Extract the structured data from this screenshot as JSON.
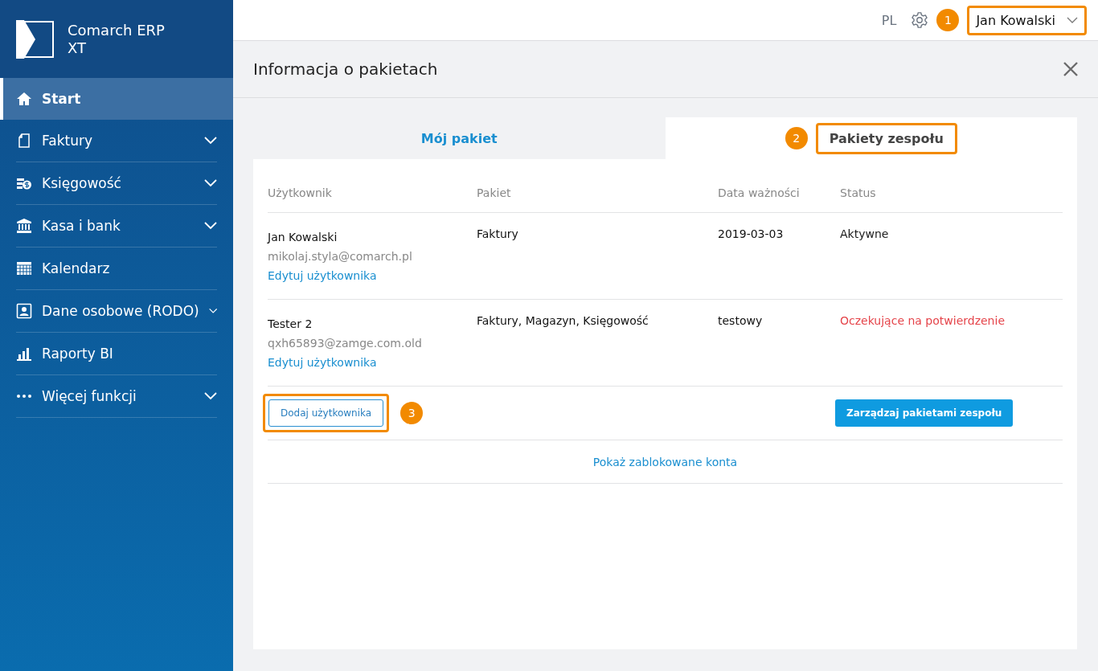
{
  "brand": {
    "line1": "Comarch ERP",
    "line2": "XT"
  },
  "sidebar": {
    "items": [
      {
        "kind": "home",
        "label": "Start",
        "selected": true,
        "expandable": false
      },
      {
        "kind": "document",
        "label": "Faktury",
        "selected": false,
        "expandable": true
      },
      {
        "kind": "money",
        "label": "Księgowość",
        "selected": false,
        "expandable": true
      },
      {
        "kind": "bank",
        "label": "Kasa i bank",
        "selected": false,
        "expandable": true
      },
      {
        "kind": "calendar",
        "label": "Kalendarz",
        "selected": false,
        "expandable": false
      },
      {
        "kind": "person",
        "label": "Dane osobowe (RODO)",
        "selected": false,
        "expandable": true
      },
      {
        "kind": "chart",
        "label": "Raporty BI",
        "selected": false,
        "expandable": false
      },
      {
        "kind": "dots",
        "label": "Więcej funkcji",
        "selected": false,
        "expandable": true
      }
    ]
  },
  "topbar": {
    "language": "PL",
    "user": {
      "name": "Jan Kowalski",
      "marker": "1",
      "highlighted": true
    }
  },
  "page_title": "Informacja o pakietach",
  "tabs": [
    {
      "label": "Mój pakiet",
      "selected": false,
      "highlighted": false
    },
    {
      "label": "Pakiety zespołu",
      "selected": true,
      "highlighted": true,
      "marker": "2"
    }
  ],
  "table": {
    "columns": [
      "Użytkownik",
      "Pakiet",
      "Data ważności",
      "Status"
    ],
    "rows": [
      {
        "name": "Jan Kowalski",
        "email": "mikolaj.styla@comarch.pl",
        "edit_link": "Edytuj użytkownika",
        "package": "Faktury",
        "expiry": "2019-03-03",
        "status": {
          "text": "Aktywne",
          "color": "#1a1a1a"
        }
      },
      {
        "name": "Tester 2",
        "email": "qxh65893@zamge.com.old",
        "edit_link": "Edytuj użytkownika",
        "package": "Faktury, Magazyn, Księgowość",
        "expiry": "testowy",
        "status": {
          "text": "Oczekujące na potwierdzenie",
          "color": "#e5444a"
        }
      }
    ]
  },
  "add_user_button": {
    "label": "Dodaj użytkownika",
    "highlighted": true,
    "marker": "3"
  },
  "manage_button": {
    "label": "Zarządzaj pakietami zespołu"
  },
  "blocked_link": "Pokaż zablokowane konta"
}
